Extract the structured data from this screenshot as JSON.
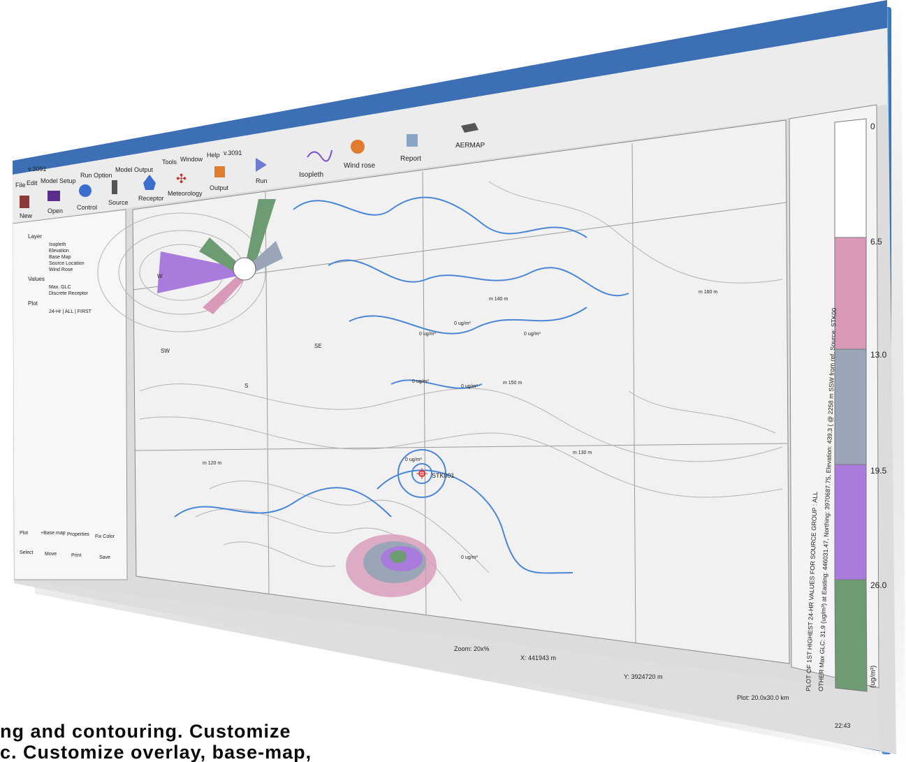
{
  "window": {
    "version": "v.3091",
    "menu": [
      "File",
      "Edit",
      "Model Setup",
      "Run Option",
      "Model Output",
      "Tools",
      "Window",
      "Help"
    ]
  },
  "toolbar": [
    {
      "label": "New",
      "icon": "new-file-icon"
    },
    {
      "label": "Open",
      "icon": "open-folder-icon"
    },
    {
      "label": "Control",
      "icon": "gear-icon"
    },
    {
      "label": "Source",
      "icon": "stack-icon"
    },
    {
      "label": "Receptor",
      "icon": "house-icon"
    },
    {
      "label": "Meteorology",
      "icon": "wind-turbine-icon"
    },
    {
      "label": "Output",
      "icon": "output-icon"
    },
    {
      "label": "Run",
      "icon": "play-icon"
    },
    {
      "label": "Isopleth",
      "icon": "isopleth-icon"
    },
    {
      "label": "Wind rose",
      "icon": "wind-rose-icon"
    },
    {
      "label": "Report",
      "icon": "report-icon"
    },
    {
      "label": "AERMAP",
      "icon": "aermap-icon"
    }
  ],
  "tree": {
    "layer": "Layer",
    "layer_items": [
      "Isopleth",
      "Elevation",
      "Base Map",
      "Source Location",
      "Wind Rose"
    ],
    "values": "Values",
    "values_items": [
      "Max. GLC",
      "Discrete Receptor"
    ],
    "plot": "Plot",
    "plot_items": [
      "24-Hr | ALL | FIRST"
    ]
  },
  "bottom_tools": [
    {
      "label": "Plot",
      "icon": "plot-icon"
    },
    {
      "label": "+Base map",
      "icon": "base-map-icon"
    },
    {
      "label": "Properties",
      "icon": "properties-icon"
    },
    {
      "label": "Fix Color",
      "icon": "fix-color-icon"
    },
    {
      "label": "Select",
      "icon": "select-icon"
    },
    {
      "label": "Move",
      "icon": "move-icon"
    },
    {
      "label": "Print",
      "icon": "print-icon"
    },
    {
      "label": "Save",
      "icon": "save-icon"
    }
  ],
  "map": {
    "wind_rose_dirs": [
      "W",
      "SW",
      "S",
      "SE"
    ],
    "source_label": "STK001",
    "contour_labels": [
      "0 ug/m³",
      "0 ug/m³",
      "0 ug/m³",
      "0 ug/m³",
      "0 ug/m³",
      "0 ug/m³",
      "0 ug/m³"
    ],
    "elev_labels": [
      "m 120 m",
      "m 130 m",
      "m 140 m",
      "m 150 m",
      "m 160 m"
    ]
  },
  "legend": {
    "ticks": [
      "0",
      "6.5",
      "13.0",
      "19.5",
      "26.0",
      "(ug/m³)"
    ],
    "colors": [
      "#ffffff",
      "#d89ab8",
      "#9aa6b8",
      "#a97bdc",
      "#6e9c72"
    ],
    "title_line1": "PLOT OF 1ST HIGHEST 24-HR VALUES FOR SOURCE GROUP : ALL",
    "title_line2": "OTHER Max GLC: 31.9 (ug/m³) at Easting: 446031.47, Northing: 3970687.75, Elevation: 439.3 ( @ 2258 m SSW from ref. Source: STK00"
  },
  "status": {
    "zoom": "Zoom: 20x%",
    "x": "X: 441943 m",
    "y": "Y: 3924720 m",
    "plot": "Plot: 20.0x30.0 km",
    "clock": "22:43"
  },
  "caption": {
    "line1": "ng   and   contouring.   Customize",
    "line2": "c. Customize overlay, base-map,"
  }
}
